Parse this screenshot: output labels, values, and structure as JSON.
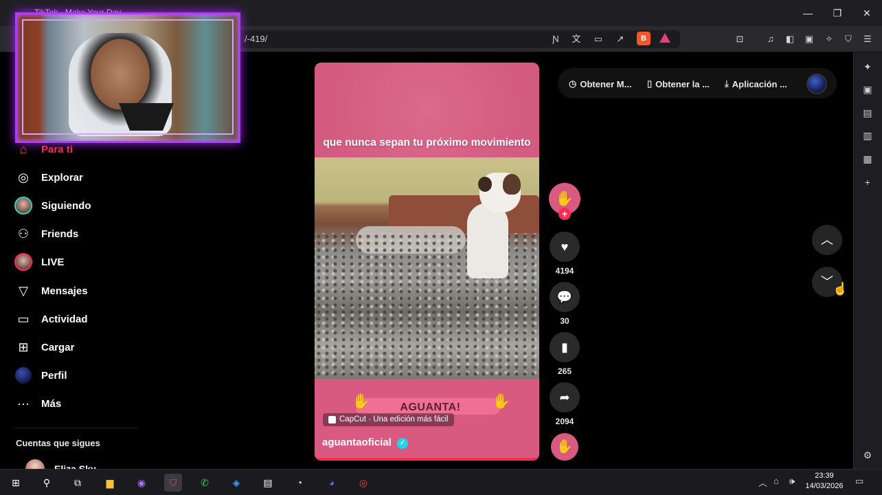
{
  "browser": {
    "tab_title": "TikTok - Make Your Day",
    "url_visible": "/-419/",
    "window_controls": [
      "minimize-icon",
      "maximize-icon",
      "close-icon"
    ]
  },
  "nav": {
    "items": [
      {
        "label": "Para ti",
        "icon": "home-icon"
      },
      {
        "label": "Explorar",
        "icon": "compass-icon"
      },
      {
        "label": "Siguiendo",
        "icon": "avatar"
      },
      {
        "label": "Friends",
        "icon": "friends-icon"
      },
      {
        "label": "LIVE",
        "icon": "avatar-live"
      },
      {
        "label": "Mensajes",
        "icon": "send-icon"
      },
      {
        "label": "Actividad",
        "icon": "activity-icon"
      },
      {
        "label": "Cargar",
        "icon": "upload-icon"
      },
      {
        "label": "Perfil",
        "icon": "profile-avatar"
      },
      {
        "label": "Más",
        "icon": "more-icon"
      }
    ],
    "following_header": "Cuentas que sigues",
    "following": [
      {
        "name": "Eliza Sky"
      }
    ]
  },
  "video": {
    "caption": "que nunca sepan tu próximo movimiento",
    "banner_text": "AGUANTA!",
    "capcut_badge": "CapCut · Una edición más fácil",
    "author": "aguantaoficial",
    "verified": true
  },
  "actions": {
    "likes": "4194",
    "comments": "30",
    "saves": "265",
    "shares": "2094"
  },
  "top_pill": {
    "item1": "Obtener M...",
    "item2": "Obtener la ...",
    "item3": "Aplicación ..."
  },
  "taskbar": {
    "time": "23:39",
    "date": "14/03/2026"
  },
  "colors": {
    "accent": "#fe2c55",
    "video_bg": "#d85a80",
    "cam_border": "#b03cff"
  }
}
